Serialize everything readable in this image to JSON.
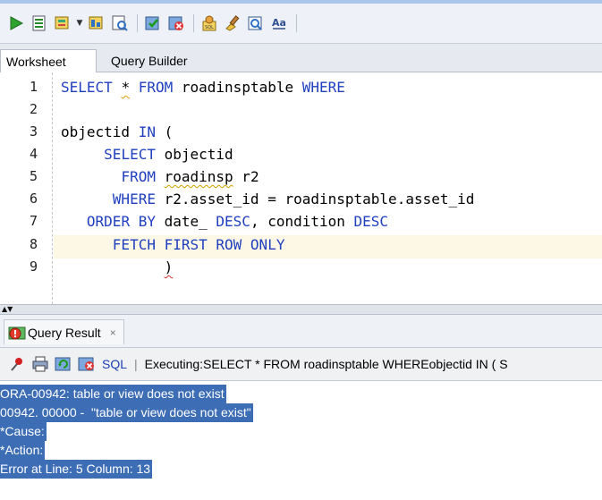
{
  "toolbar": {
    "buttons": [
      {
        "icon": "run-statement-icon"
      },
      {
        "icon": "run-script-icon"
      },
      {
        "icon": "autotrace-icon"
      },
      {
        "icon": "explain-plan-icon"
      },
      {
        "icon": "sql-tuning-icon"
      },
      {
        "icon": "commit-icon"
      },
      {
        "icon": "rollback-icon"
      },
      {
        "icon": "sql-history-icon"
      },
      {
        "icon": "clear-icon"
      },
      {
        "icon": "find-icon"
      },
      {
        "icon": "format-icon"
      }
    ]
  },
  "tabs": {
    "worksheet": "Worksheet",
    "query_builder": "Query Builder"
  },
  "editor": {
    "line_numbers": [
      "1",
      "2",
      "3",
      "4",
      "5",
      "6",
      "7",
      "8",
      "9"
    ],
    "lines": {
      "l1": {
        "kw1": "SELECT",
        "star": "*",
        "kw2": "FROM",
        "tbl": " roadinsptable ",
        "kw3": "WHERE"
      },
      "l3": {
        "col": "objectid ",
        "kw": "IN",
        "paren": " ("
      },
      "l4": {
        "indent": "     ",
        "kw": "SELECT",
        "col": " objectid"
      },
      "l5": {
        "indent": "       ",
        "kw": "FROM",
        "tbl": "roadinsp",
        "alias": " r2"
      },
      "l6": {
        "indent": "      ",
        "kw": "WHERE",
        "cond": " r2.asset_id = roadinsptable.asset_id"
      },
      "l7": {
        "indent": "   ",
        "kw1": "ORDER BY",
        "col1": " date_ ",
        "kw2": "DESC",
        "mid": ", condition ",
        "kw3": "DESC"
      },
      "l8": {
        "indent": "      ",
        "kw": "FETCH FIRST ROW ONLY"
      },
      "l9": {
        "indent": "            ",
        "paren": ")"
      }
    }
  },
  "result": {
    "tab_label": "Query Result",
    "close_glyph": "×",
    "sql_link": "SQL",
    "separator": "|",
    "executing": "Executing:SELECT * FROM roadinsptable WHEREobjectid IN (    S",
    "error_lines": [
      "ORA-00942: table or view does not exist",
      "00942. 00000 -  \"table or view does not exist\"",
      "*Cause:",
      "*Action:",
      "Error at Line: 5 Column: 13"
    ]
  },
  "colors": {
    "keyword": "#1f3fbf",
    "selection": "#3d6db5",
    "current_line": "#fdf8e6"
  }
}
